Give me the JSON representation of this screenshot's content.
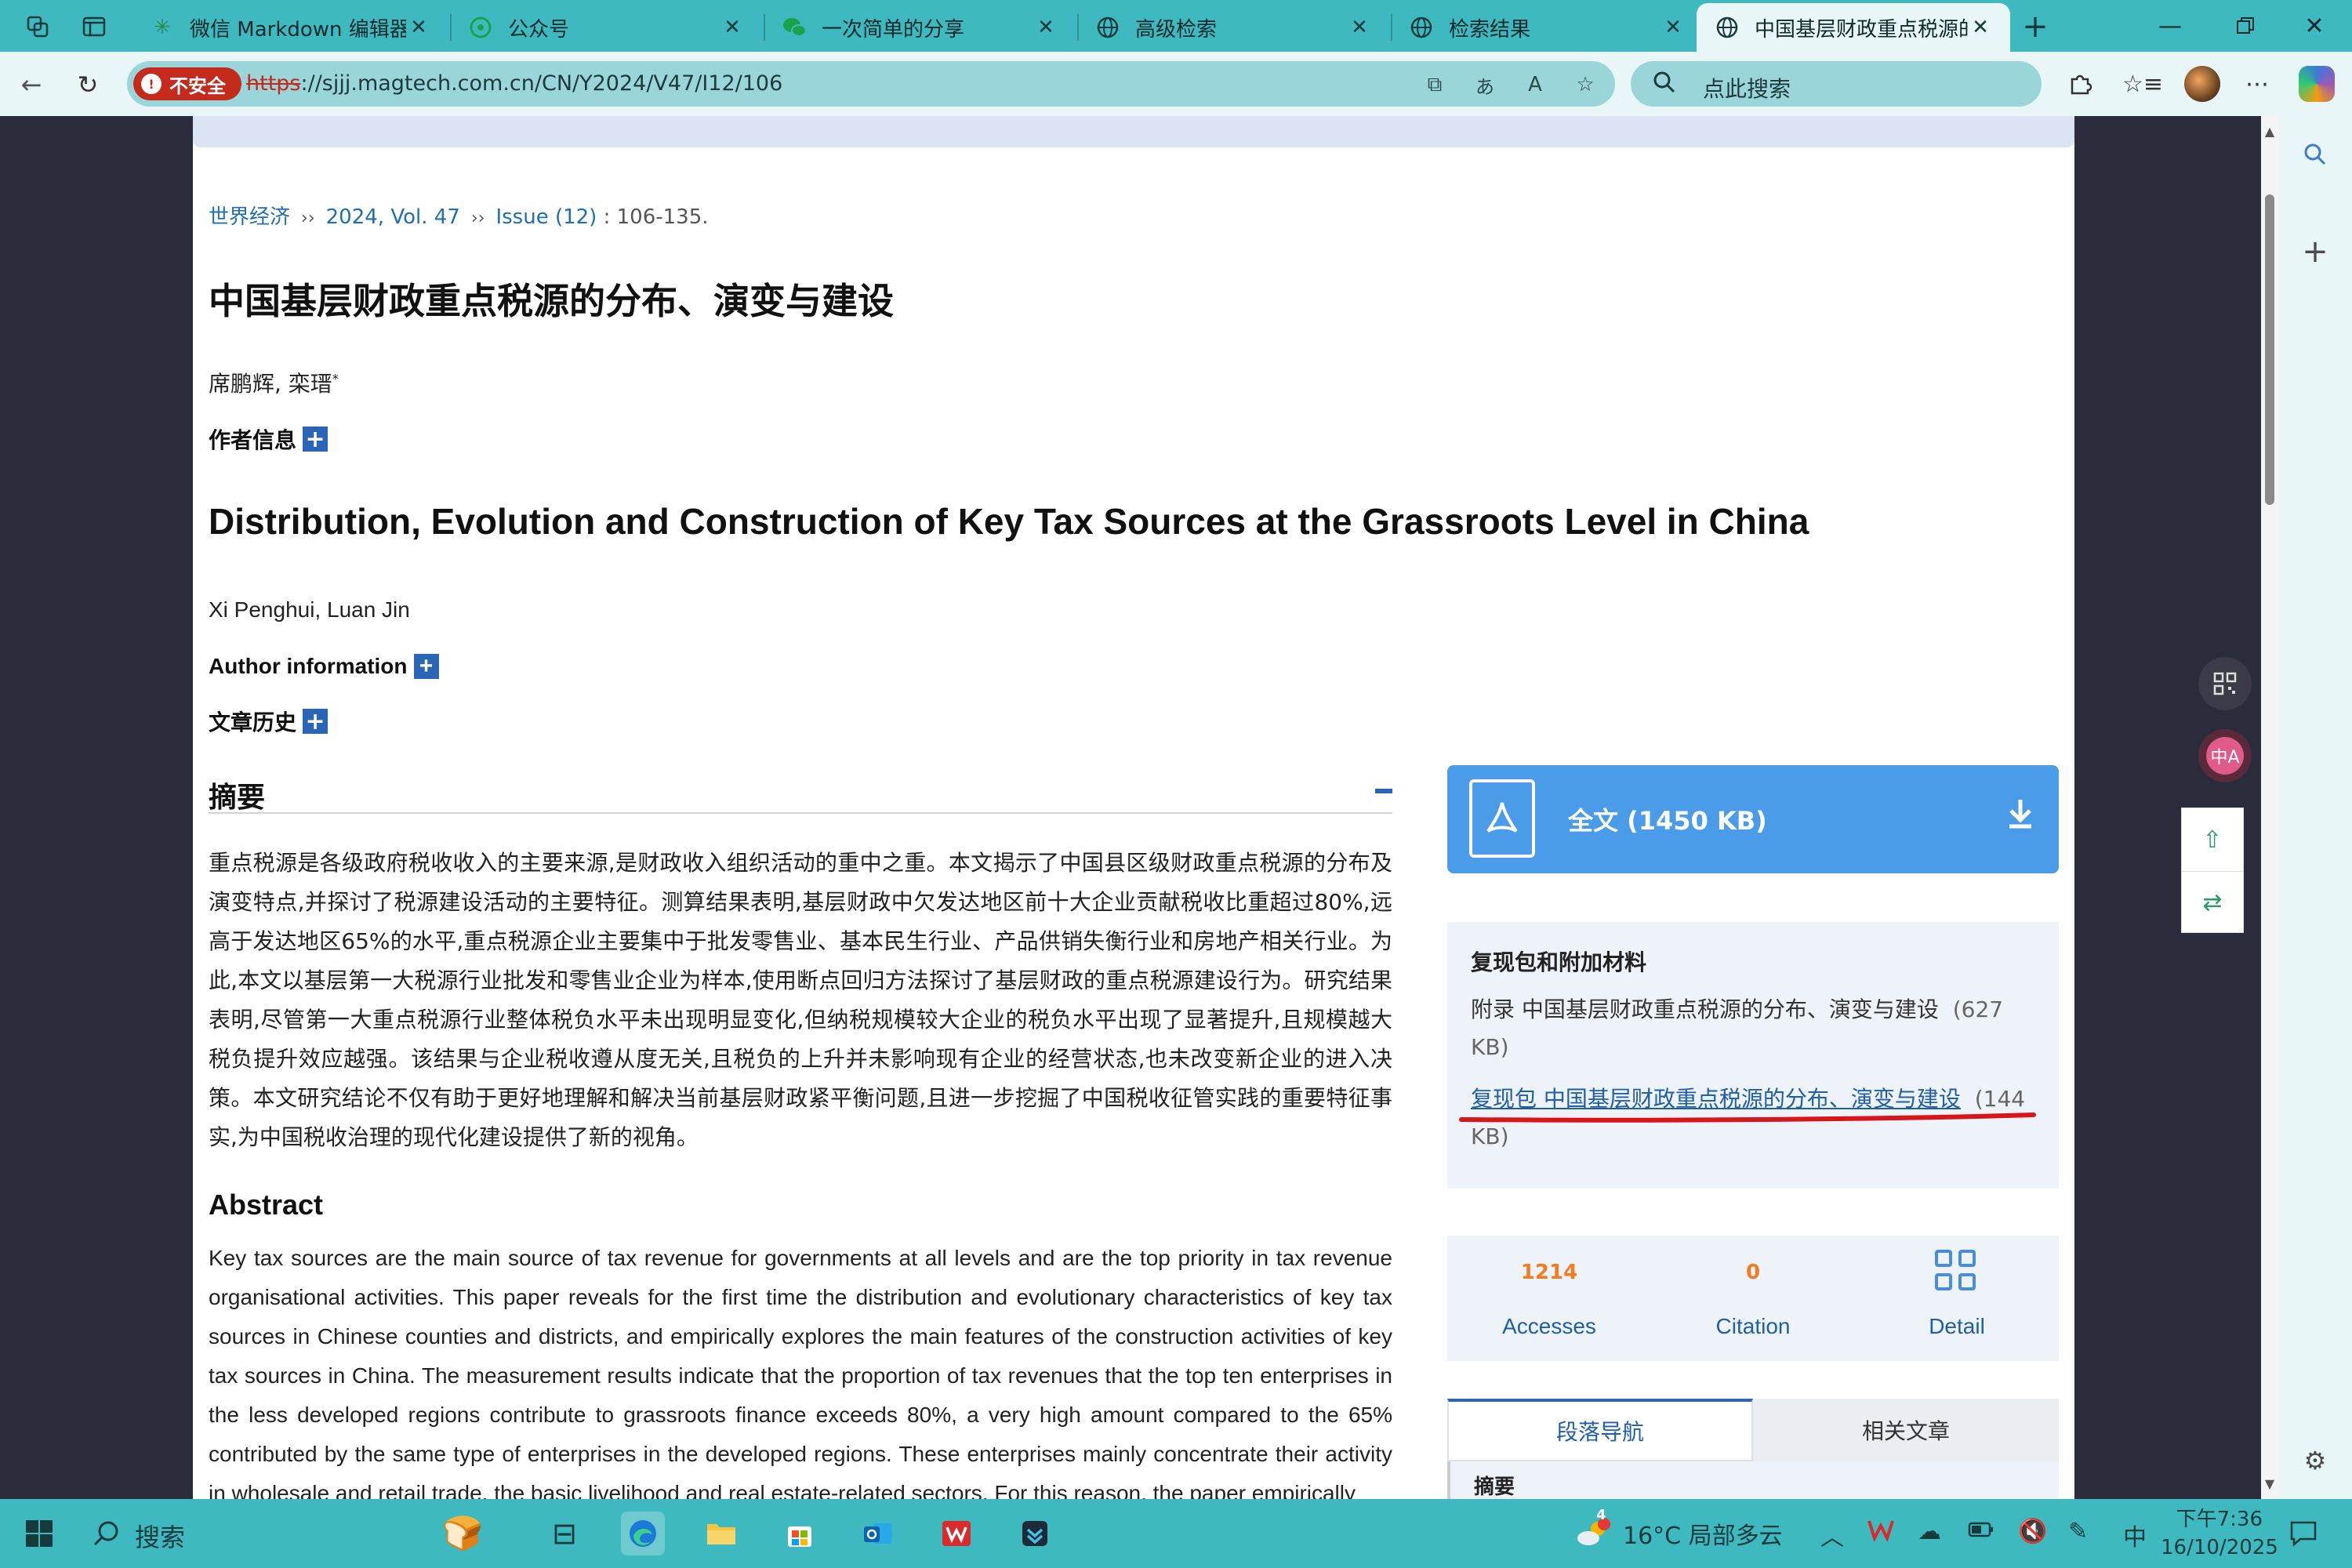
{
  "browser": {
    "tabs": [
      {
        "title": "微信 Markdown 编辑器 | ∃",
        "icon": "star-favicon-icon"
      },
      {
        "title": "公众号",
        "icon": "wechat-favicon-icon"
      },
      {
        "title": "一次简单的分享",
        "icon": "wechat-favicon-icon"
      },
      {
        "title": "高级检索",
        "icon": "globe-favicon-icon"
      },
      {
        "title": "检索结果",
        "icon": "globe-favicon-icon"
      },
      {
        "title": "中国基层财政重点税源的分",
        "icon": "globe-favicon-icon",
        "active": true
      }
    ],
    "address": {
      "insecure_label": "不安全",
      "protocol": "https",
      "url_rest": "://sjjj.magtech.com.cn/CN/Y2024/V47/I12/106"
    },
    "search_placeholder": "点此搜索"
  },
  "page": {
    "topnav": {
      "date": "",
      "items": [
        "",
        "",
        "",
        "",
        "",
        "",
        ""
      ]
    },
    "breadcrumb": {
      "journal": "世界经济",
      "volume": "2024, Vol. 47",
      "issue": "Issue (12)",
      "pages": ": 106-135.",
      "separator": "››"
    },
    "title_cn": "中国基层财政重点税源的分布、演变与建设",
    "authors_cn": "席鹏辉, 栾瑨",
    "authors_cn_mark": "*",
    "author_info_cn": "作者信息",
    "title_en": "Distribution, Evolution and Construction of Key Tax Sources at the Grassroots Level in China",
    "authors_en": "Xi Penghui, Luan Jin",
    "author_info_en": "Author information",
    "history_label": "文章历史",
    "abstract_cn_heading": "摘要",
    "abstract_cn": "重点税源是各级政府税收收入的主要来源,是财政收入组织活动的重中之重。本文揭示了中国县区级财政重点税源的分布及演变特点,并探讨了税源建设活动的主要特征。测算结果表明,基层财政中欠发达地区前十大企业贡献税收比重超过80%,远高于发达地区65%的水平,重点税源企业主要集中于批发零售业、基本民生行业、产品供销失衡行业和房地产相关行业。为此,本文以基层第一大税源行业批发和零售业企业为样本,使用断点回归方法探讨了基层财政的重点税源建设行为。研究结果表明,尽管第一大重点税源行业整体税负水平未出现明显变化,但纳税规模较大企业的税负水平出现了显著提升,且规模越大税负提升效应越强。该结果与企业税收遵从度无关,且税负的上升并未影响现有企业的经营状态,也未改变新企业的进入决策。本文研究结论不仅有助于更好地理解和解决当前基层财政紧平衡问题,且进一步挖掘了中国税收征管实践的重要特征事实,为中国税收治理的现代化建设提供了新的视角。",
    "abstract_en_heading": "Abstract",
    "abstract_en": "Key tax sources are the main source of tax revenue for governments at all levels and are the top priority in tax revenue organisational activities. This paper reveals for the first time the distribution and evolutionary characteristics of key tax sources in Chinese counties and districts, and empirically explores the main features of the construction activities of key tax sources in China. The measurement results indicate that the proportion of tax revenues that the top ten enterprises in the less developed regions contribute to grassroots finance exceeds 80%, a very high amount compared to the 65% contributed by the same type of enterprises in the developed regions. These enterprises mainly concentrate their activity in wholesale and retail trade, the basic livelihood and real estate-related sectors. For this reason, the paper empirically",
    "fulltext": {
      "label": "全文 (1450 KB)"
    },
    "supplementary": {
      "heading": "复现包和附加材料",
      "items": [
        {
          "text": "附录 中国基层财政重点税源的分布、演变与建设",
          "size": "(627 KB)"
        },
        {
          "text": "复现包 中国基层财政重点税源的分布、演变与建设",
          "size": "(144 KB)"
        }
      ]
    },
    "metrics": {
      "accesses_value": "1214",
      "accesses_label": "Accesses",
      "citation_value": "0",
      "citation_label": "Citation",
      "detail_label": "Detail"
    },
    "nav_tabs": {
      "tab1": "段落导航",
      "tab2": "相关文章",
      "content_first": "摘要"
    }
  },
  "taskbar": {
    "search_label": "搜索",
    "weather": "16°C  局部多云",
    "weather_badge": "4",
    "ime": "中",
    "time": "下午7:36",
    "date": "16/10/2025"
  },
  "colors": {
    "accent": "#3fb9c0",
    "link": "#1f6fb2",
    "download": "#4a9ce8",
    "metric_number": "#f47b20",
    "insecure": "#c42b1c",
    "annotation_red": "#d8151b"
  }
}
